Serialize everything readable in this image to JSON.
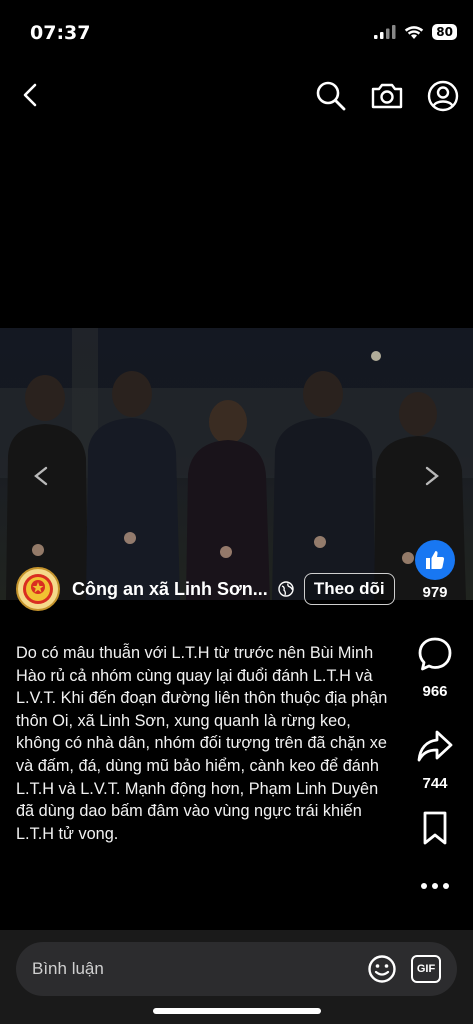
{
  "status_bar": {
    "time": "07:37",
    "battery": "80"
  },
  "post": {
    "account_name": "Công an xã Linh Sơn...",
    "follow_label": "Theo dõi",
    "caption": "Do có mâu thuẫn với L.T.H từ trước nên Bùi Minh Hào rủ cả nhóm cùng quay lại đuổi đánh L.T.H và L.V.T. Khi đến đoạn đường liên thôn thuộc địa phận thôn Oi, xã Linh Sơn, xung quanh là rừng keo, không có nhà dân, nhóm đối tượng trên đã chặn xe và đấm, đá, dùng mũ bảo hiểm, cành keo để đánh L.T.H và L.V.T. Mạnh động hơn, Phạm Linh Duyên đã dùng dao bấm đâm vào vùng ngực trái khiến L.T.H tử vong."
  },
  "actions": {
    "likes": "979",
    "comments": "966",
    "shares": "744"
  },
  "comment_bar": {
    "placeholder": "Bình luận",
    "gif_label": "GIF"
  },
  "icons": {
    "back": "chevron-left-icon",
    "search": "search-icon",
    "camera": "camera-icon",
    "profile": "profile-icon",
    "like": "thumbs-up-icon",
    "comment": "comment-bubble-icon",
    "share": "share-arrow-icon",
    "save": "bookmark-icon",
    "more": "more-dots-icon",
    "emoji": "emoji-icon"
  },
  "colors": {
    "like_blue": "#1877f2",
    "background": "#0b0b0d",
    "comment_bar": "#1a1a1a"
  }
}
